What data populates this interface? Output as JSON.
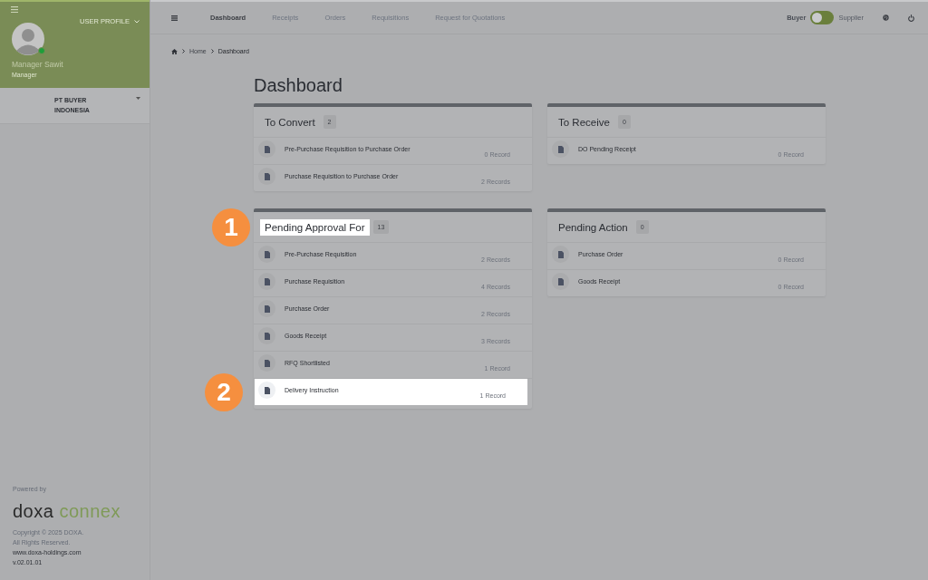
{
  "sidebar": {
    "profile_label": "USER PROFILE",
    "user_name": "Manager Sawit",
    "user_role": "Manager",
    "online": true,
    "company": "PT BUYER INDONESIA",
    "powered_by": "Powered by",
    "logo": [
      "doxa",
      "connex"
    ],
    "footer": [
      "Copyright © 2025 DOXA.",
      "All Rights Reserved.",
      "www.doxa-holdings.com",
      "v.02.01.01"
    ]
  },
  "topbar": {
    "nav": [
      {
        "label": "Dashboard",
        "selected": true
      },
      {
        "label": "Receipts",
        "selected": false
      },
      {
        "label": "Orders",
        "selected": false
      },
      {
        "label": "Requisitions",
        "selected": false
      },
      {
        "label": "Request for Quotations",
        "selected": false
      }
    ],
    "role_toggle": [
      {
        "label": "Buyer",
        "selected": true
      },
      {
        "label": "Supplier",
        "selected": false
      }
    ]
  },
  "breadcrumb": [
    "Home",
    "Dashboard"
  ],
  "page_title": "Dashboard",
  "panels": [
    {
      "title": "To Convert",
      "count": "2",
      "highlighted": false,
      "rows": [
        {
          "label": "Pre-Purchase Requisition to Purchase Order",
          "records": "0 Record",
          "highlighted": false
        },
        {
          "label": "Purchase Requisition to Purchase Order",
          "records": "2 Records",
          "highlighted": false
        }
      ]
    },
    {
      "title": "To Receive",
      "count": "0",
      "highlighted": false,
      "rows": [
        {
          "label": "DO Pending Receipt",
          "records": "0 Record",
          "highlighted": false
        }
      ]
    },
    {
      "title": "Pending Approval For",
      "count": "13",
      "highlighted": true,
      "callout": "1",
      "rows": [
        {
          "label": "Pre-Purchase Requisition",
          "records": "2 Records",
          "highlighted": false
        },
        {
          "label": "Purchase Requisition",
          "records": "4 Records",
          "highlighted": false
        },
        {
          "label": "Purchase Order",
          "records": "2 Records",
          "highlighted": false
        },
        {
          "label": "Goods Receipt",
          "records": "3 Records",
          "highlighted": false
        },
        {
          "label": "RFQ Shortlisted",
          "records": "1 Record",
          "highlighted": false
        },
        {
          "label": "Delivery Instruction",
          "records": "1 Record",
          "highlighted": true,
          "callout": "2"
        }
      ]
    },
    {
      "title": "Pending Action",
      "count": "0",
      "highlighted": false,
      "rows": [
        {
          "label": "Purchase Order",
          "records": "0 Record",
          "highlighted": false
        },
        {
          "label": "Goods Receipt",
          "records": "0 Record",
          "highlighted": false
        }
      ]
    }
  ]
}
